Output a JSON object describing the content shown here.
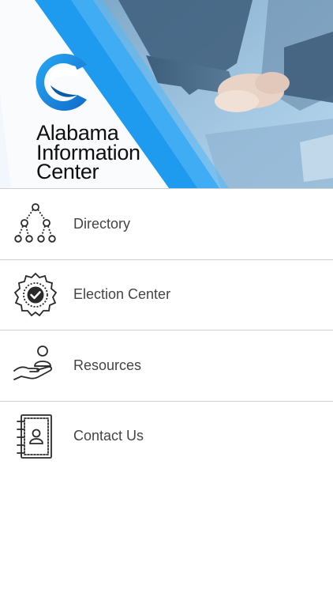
{
  "banner": {
    "brand_lines": [
      "Alabama",
      "Information",
      "Center"
    ],
    "accent_color": "#1a96e8",
    "photo_tint": "#9fc8e8"
  },
  "menu": {
    "items": [
      {
        "label": "Directory",
        "icon": "org-chart-icon"
      },
      {
        "label": "Election Center",
        "icon": "check-badge-icon"
      },
      {
        "label": "Resources",
        "icon": "hand-person-icon"
      },
      {
        "label": "Contact Us",
        "icon": "address-book-icon"
      }
    ]
  }
}
